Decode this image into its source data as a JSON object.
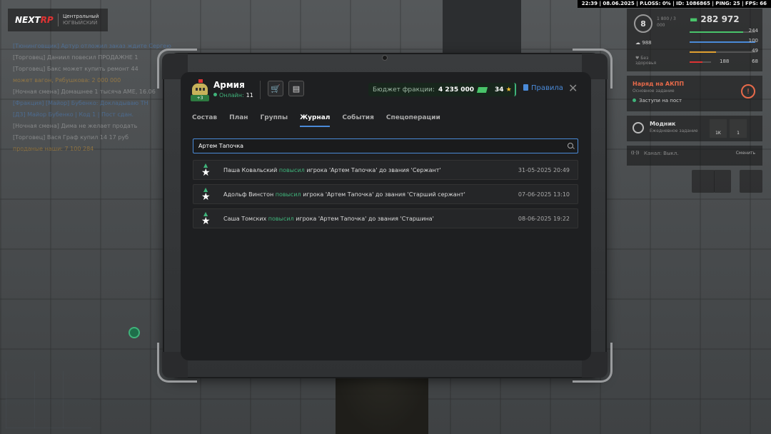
{
  "status_bar": "22:39 | 08.06.2025 | P.LOSS: 0% | ID: 1086865 | PING: 25 | FPS: 66",
  "hud_left": {
    "logo_brand_prefix": "NEXT",
    "logo_brand_suffix": "RP",
    "logo_server": "Центральный",
    "logo_server_sub": "ЮГВЫЙСКИЙ",
    "chat": [
      {
        "text": "[Тюнинговщик] Артур отложил заказ ждите Сергею",
        "color": "blue"
      },
      {
        "text": "[Торговец] Даниил повесил ПРОДАЖНЕ 1",
        "color": "grey"
      },
      {
        "text": "[Торговец] Бакс может купить ремонт 44",
        "color": "grey"
      },
      {
        "text": "может вагон, Рябушкова: 2 000 000",
        "color": "orange"
      },
      {
        "text": "[Ночная смена] Домашнее 1 тысяча АМЕ, 16.06",
        "color": "grey"
      },
      {
        "text": "[Фракция] [Майор] Бубенко: Докладываю ТН",
        "color": "blue"
      },
      {
        "text": "[Д3] Майор Бубенко | Код 1 | Пост сдан.",
        "color": "blue"
      },
      {
        "text": "[Ночная смена] Дима не желает продать",
        "color": "grey"
      },
      {
        "text": "[Торговец] Вася Граф купил 14 17 руб",
        "color": "grey"
      },
      {
        "text": "проданые наши: 7 100 284",
        "color": "orange"
      }
    ]
  },
  "hud_right": {
    "level": "8",
    "xp": "1 800 / 3 000",
    "money": "282 972",
    "stat_a": "988",
    "stat_b": "Без здоровья",
    "bars": [
      {
        "value": "244",
        "color": "#49c46a"
      },
      {
        "value": "100",
        "color": "#4a8ad8"
      },
      {
        "value": "49",
        "color": "#e0a030"
      },
      {
        "value": "68",
        "color": "#d33"
      }
    ],
    "stat_c": "188",
    "task_title": "Наряд на АКПП",
    "task_sub": "Основное задание",
    "task_goal": "Заступи на пост",
    "fashion_title": "Модник",
    "fashion_sub": "Ежедневное задание",
    "fashion_a": "1K",
    "fashion_b": "1",
    "radio_label": "Канал: Выкл.",
    "radio_right": "Сменить"
  },
  "header": {
    "faction_name": "Армия",
    "faction_badge": "+3",
    "online_label": "Онлайн:",
    "online_count": "11",
    "budget_label": "Бюджет фракции:",
    "budget_amount": "4 235 000",
    "stars": "34",
    "rules_label": "Правила",
    "close_glyph": "✕"
  },
  "tabs": [
    {
      "label": "Состав",
      "active": false
    },
    {
      "label": "План",
      "active": false
    },
    {
      "label": "Группы",
      "active": false
    },
    {
      "label": "Журнал",
      "active": true
    },
    {
      "label": "События",
      "active": false
    },
    {
      "label": "Спецоперации",
      "active": false
    }
  ],
  "search": {
    "value": "Артем Тапочка",
    "placeholder": ""
  },
  "log": [
    {
      "actor": "Паша Ковальский",
      "action": "повысил",
      "target": "игрока 'Артем Тапочка' до звания 'Сержант'",
      "date": "31-05-2025 20:49"
    },
    {
      "actor": "Адольф Винстон",
      "action": "повысил",
      "target": "игрока 'Артем Тапочка' до звания 'Старший сержант'",
      "date": "07-06-2025 13:10"
    },
    {
      "actor": "Саша Томских",
      "action": "повысил",
      "target": "игрока 'Артем Тапочка' до звания 'Старшина'",
      "date": "08-06-2025 19:22"
    }
  ],
  "colors": {
    "accent": "#4a8ad8",
    "positive": "#3fb37a",
    "panel": "#1e1f21"
  },
  "icons": {
    "shop": "cart-icon",
    "calculator": "calculator-icon",
    "rank": "rank-up-icon",
    "search": "search-icon"
  }
}
